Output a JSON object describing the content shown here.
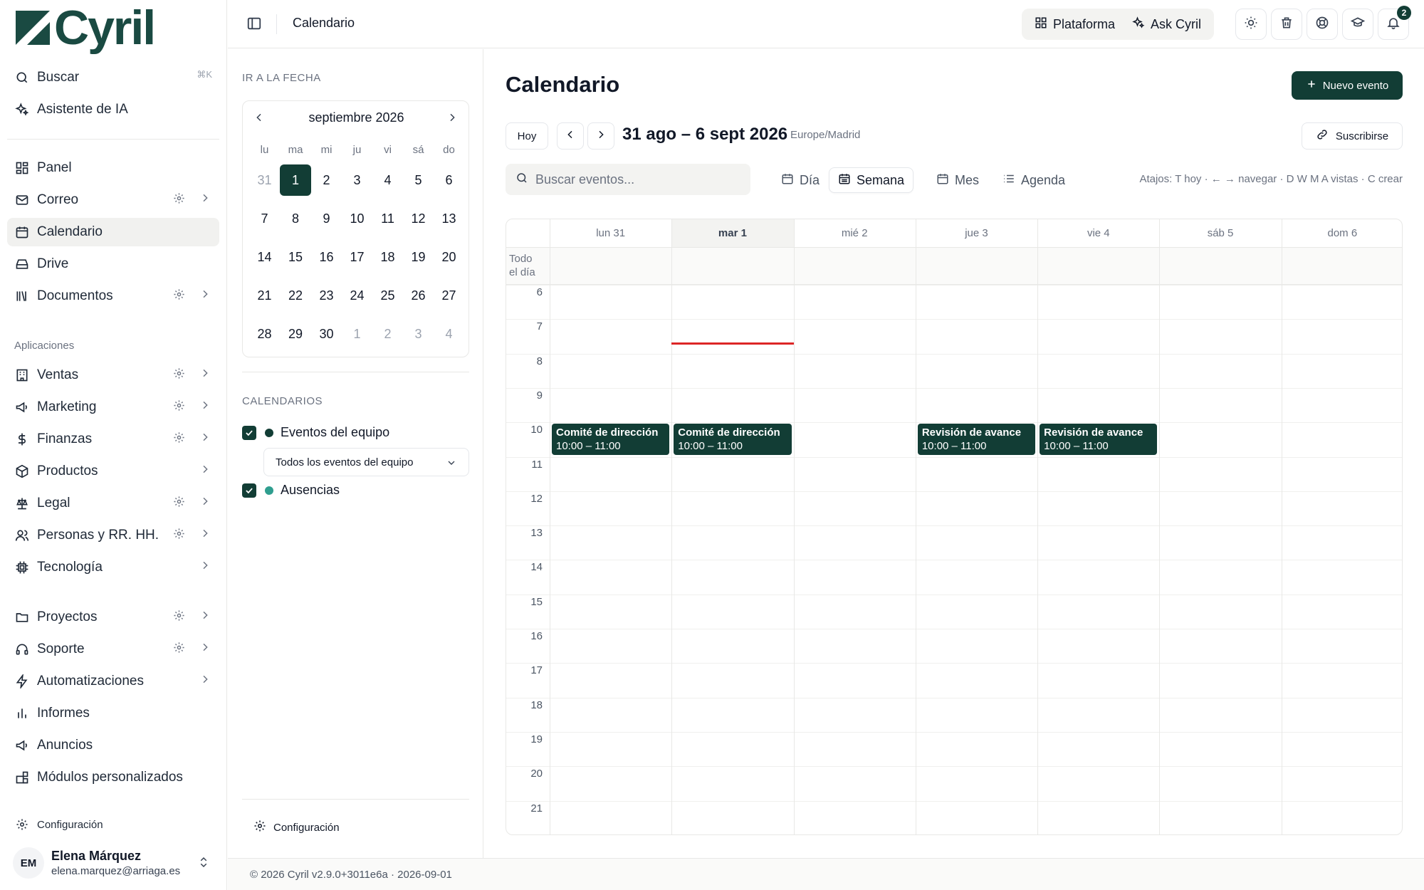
{
  "brand": {
    "name": "Cyril",
    "color": "#1a4a42",
    "accent": "#123d35"
  },
  "sidebar": {
    "search_label": "Buscar",
    "search_shortcut": "⌘K",
    "ai_label": "Asistente de IA",
    "main_items": [
      {
        "label": "Panel",
        "icon": "layout-grid-icon"
      },
      {
        "label": "Correo",
        "icon": "mail-icon"
      },
      {
        "label": "Calendario",
        "icon": "calendar-icon",
        "active": true
      },
      {
        "label": "Drive",
        "icon": "hard-drive-icon"
      },
      {
        "label": "Documentos",
        "icon": "library-icon"
      }
    ],
    "apps_label": "Aplicaciones",
    "app_items": [
      {
        "label": "Ventas",
        "icon": "building-icon"
      },
      {
        "label": "Marketing",
        "icon": "megaphone-icon"
      },
      {
        "label": "Finanzas",
        "icon": "dollar-icon"
      },
      {
        "label": "Productos",
        "icon": "package-icon"
      },
      {
        "label": "Legal",
        "icon": "scale-icon"
      },
      {
        "label": "Personas y RR. HH.",
        "icon": "users-icon"
      },
      {
        "label": "Tecnología",
        "icon": "cpu-icon"
      }
    ],
    "other_items": [
      {
        "label": "Proyectos",
        "icon": "folder-icon"
      },
      {
        "label": "Soporte",
        "icon": "headphones-icon"
      },
      {
        "label": "Automatizaciones",
        "icon": "zap-icon"
      },
      {
        "label": "Informes",
        "icon": "bar-chart-icon"
      },
      {
        "label": "Anuncios",
        "icon": "megaphone-icon"
      },
      {
        "label": "Módulos personalizados",
        "icon": "blocks-icon"
      }
    ],
    "settings_label": "Configuración",
    "user": {
      "initials": "EM",
      "name": "Elena Márquez",
      "email": "elena.marquez@arriaga.es"
    }
  },
  "topbar": {
    "breadcrumb": "Calendario",
    "platform_label": "Plataforma",
    "ask_label": "Ask Cyril",
    "notification_count": "2"
  },
  "minipanel": {
    "goto_label": "IR A LA FECHA",
    "month_label": "septiembre 2026",
    "dow": [
      "lu",
      "ma",
      "mi",
      "ju",
      "vi",
      "sá",
      "do"
    ],
    "weeks": [
      [
        "31",
        "1",
        "2",
        "3",
        "4",
        "5",
        "6"
      ],
      [
        "7",
        "8",
        "9",
        "10",
        "11",
        "12",
        "13"
      ],
      [
        "14",
        "15",
        "16",
        "17",
        "18",
        "19",
        "20"
      ],
      [
        "21",
        "22",
        "23",
        "24",
        "25",
        "26",
        "27"
      ],
      [
        "28",
        "29",
        "30",
        "1",
        "2",
        "3",
        "4"
      ]
    ],
    "selected_day": "1",
    "calendars_label": "CALENDARIOS",
    "calendars": [
      {
        "label": "Eventos del equipo",
        "color": "#123d35",
        "checked": true
      },
      {
        "label": "Ausencias",
        "color": "#2f9e8f",
        "checked": true
      }
    ],
    "filter_value": "Todos los eventos del equipo",
    "config_label": "Configuración"
  },
  "main": {
    "title": "Calendario",
    "new_event_label": "Nuevo evento",
    "today_label": "Hoy",
    "range_label": "31 ago – 6 sept 2026",
    "timezone": "Europe/Madrid",
    "subscribe_label": "Suscribirse",
    "search_placeholder": "Buscar eventos...",
    "views": [
      {
        "label": "Día",
        "icon": "calendar-icon"
      },
      {
        "label": "Semana",
        "icon": "calendar-week-icon",
        "active": true
      },
      {
        "label": "Mes",
        "icon": "calendar-icon"
      },
      {
        "label": "Agenda",
        "icon": "list-icon"
      }
    ],
    "shortcuts": "Atajos: T hoy · ← → navegar · D W M A vistas · C crear",
    "allday_label": "Todo el día",
    "days": [
      "lun 31",
      "mar 1",
      "mié 2",
      "jue 3",
      "vie 4",
      "sáb 5",
      "dom 6"
    ],
    "today_index": 1,
    "hours": [
      "6",
      "7",
      "8",
      "9",
      "10",
      "11",
      "12",
      "13",
      "14",
      "15",
      "16",
      "17",
      "18",
      "19",
      "20",
      "21"
    ],
    "now_time": "7:40",
    "events": [
      {
        "day": 0,
        "title": "Comité de dirección",
        "time": "10:00 – 11:00"
      },
      {
        "day": 1,
        "title": "Comité de dirección",
        "time": "10:00 – 11:00"
      },
      {
        "day": 3,
        "title": "Revisión de avance",
        "time": "10:00 – 11:00"
      },
      {
        "day": 4,
        "title": "Revisión de avance",
        "time": "10:00 – 11:00"
      }
    ]
  },
  "footer": {
    "text": "© 2026 Cyril v2.9.0+3011e6a · 2026-09-01"
  }
}
